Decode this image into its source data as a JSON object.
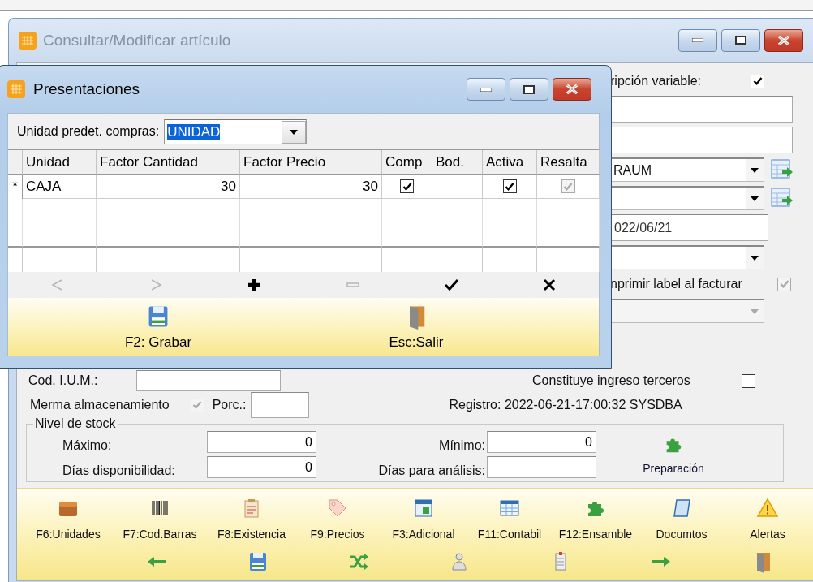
{
  "main_window": {
    "title": "Consultar/Modificar artículo",
    "active": false
  },
  "right_column": [
    {
      "kind": "checkbox",
      "label": "ripción variable:",
      "checked": true,
      "disabled": false
    },
    {
      "kind": "text"
    },
    {
      "kind": "text"
    },
    {
      "kind": "combo",
      "value": "RAUM",
      "linked": true,
      "disabled": false
    },
    {
      "kind": "combo",
      "linked": true,
      "disabled": false
    },
    {
      "kind": "text",
      "value": "022/06/21"
    },
    {
      "kind": "combo",
      "disabled": false
    },
    {
      "kind": "checkbox",
      "label": "nprimir label al facturar",
      "checked": true,
      "disabled": true
    },
    {
      "kind": "combo",
      "disabled": true
    }
  ],
  "cod_ium": {
    "label": "Cod. I.U.M.:"
  },
  "ingreso_terceros": {
    "label": "Constituye ingreso terceros",
    "checked": false
  },
  "merma": {
    "label": "Merma almacenamiento",
    "checked": true,
    "disabled": true
  },
  "porc": {
    "label": "Porc.:"
  },
  "registro": "Registro: 2022-06-21-17:00:32 SYSDBA",
  "stock": {
    "title": "Nivel de stock",
    "fields": [
      {
        "label": "Máximo:",
        "value": "0"
      },
      {
        "label": "Mínimo:",
        "value": "0"
      },
      {
        "label": "Días disponibilidad:",
        "value": "0"
      },
      {
        "label": "Días para análisis:"
      }
    ],
    "button": "Preparación"
  },
  "toolbar": [
    {
      "kind": "units",
      "label": "F6:Unidades"
    },
    {
      "kind": "barcode",
      "label": "F7:Cod.Barras"
    },
    {
      "kind": "stock",
      "label": "F8:Existencia"
    },
    {
      "kind": "prices",
      "label": "F9:Precios"
    },
    {
      "kind": "extra",
      "label": "F3:Adicional"
    },
    {
      "kind": "accounting",
      "label": "F11:Contabil"
    },
    {
      "kind": "assembly",
      "label": "F12:Ensamble"
    },
    {
      "kind": "documents",
      "label": "Documtos"
    },
    {
      "kind": "alerts",
      "label": "Alertas"
    }
  ],
  "toolbar_row_2": [
    {
      "kind": "back"
    },
    {
      "kind": "save"
    },
    {
      "kind": "shuffle"
    },
    {
      "kind": "person"
    },
    {
      "kind": "document"
    },
    {
      "kind": "forward"
    },
    {
      "kind": "exit"
    }
  ],
  "dialog": {
    "title": "Presentaciones",
    "active": true,
    "default_unit": {
      "label": "Unidad predet. compras:",
      "value": "UNIDAD",
      "highlighted": true
    },
    "grid": {
      "columns": [
        "Unidad",
        "Factor Cantidad",
        "Factor Precio",
        "Comp",
        "Bod.",
        "Activa",
        "Resalta"
      ],
      "rows": [
        {
          "indicator": "*",
          "cells": [
            {
              "kind": "text",
              "value": "CAJA"
            },
            {
              "kind": "number",
              "value": "30"
            },
            {
              "kind": "number",
              "value": "30"
            },
            {
              "kind": "check",
              "checked": true,
              "disabled": false
            },
            {
              "kind": "empty"
            },
            {
              "kind": "check",
              "checked": true,
              "disabled": false
            },
            {
              "kind": "check",
              "checked": true,
              "disabled": true
            }
          ]
        }
      ]
    },
    "navigator": [
      {
        "kind": "prior",
        "disabled": true
      },
      {
        "kind": "next",
        "disabled": true
      },
      {
        "kind": "insert",
        "disabled": false
      },
      {
        "kind": "delete",
        "disabled": true
      },
      {
        "kind": "post",
        "disabled": false
      },
      {
        "kind": "cancel",
        "disabled": false
      }
    ],
    "buttons": [
      {
        "kind": "save",
        "label": "F2: Grabar"
      },
      {
        "kind": "exit",
        "label": "Esc:Salir"
      }
    ]
  }
}
